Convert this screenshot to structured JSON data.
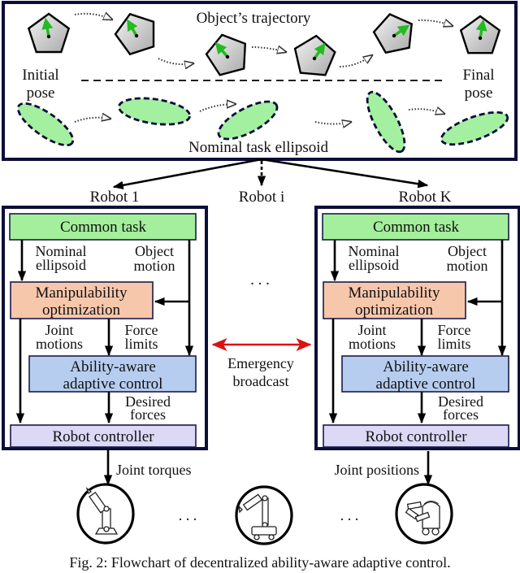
{
  "figure": {
    "caption": "Fig. 2: Flowchart of decentralized ability-aware adaptive control."
  },
  "top_panel": {
    "title_top": "Object’s trajectory",
    "title_bottom": "Nominal task ellipsoid",
    "initial_pose": [
      "Initial",
      "pose"
    ],
    "final_pose": [
      "Final",
      "pose"
    ],
    "colors": {
      "ellipse_fill": "#a3f0a0",
      "arrow_green": "#22bb22",
      "pentagon_fill": "#d8d8d8"
    }
  },
  "robots": {
    "robot_1": "Robot 1",
    "robot_i": "Robot i",
    "robot_k": "Robot K",
    "middle_dots": ". . ."
  },
  "robot_block": {
    "common_task": "Common task",
    "nominal_ellipsoid": [
      "Nominal",
      "ellipsoid"
    ],
    "object_motion": [
      "Object",
      "motion"
    ],
    "manipulability": [
      "Manipulability",
      "optimization"
    ],
    "joint_motions": [
      "Joint",
      "motions"
    ],
    "force_limits": [
      "Force",
      "limits"
    ],
    "adaptive_control": [
      "Ability-aware",
      "adaptive control"
    ],
    "desired_forces": [
      "Desired",
      "forces"
    ],
    "robot_controller": "Robot controller",
    "colors": {
      "common_task": "#a3ef9b",
      "manipulability": "#f7c7ac",
      "adaptive_control": "#b7cdef",
      "robot_controller": "#dcd8f5",
      "frame": "#0d0d3a"
    }
  },
  "emergency": {
    "label": [
      "Emergency",
      "broadcast"
    ],
    "color": "#dd1111"
  },
  "outputs": {
    "left": "Joint torques",
    "right": "Joint positions",
    "dots_left": ". . .",
    "dots_right": ". . ."
  },
  "robot_icons": [
    {
      "name": "fixed-arm-robot"
    },
    {
      "name": "mobile-arm-robot"
    },
    {
      "name": "dual-arm-mobile-robot"
    }
  ]
}
